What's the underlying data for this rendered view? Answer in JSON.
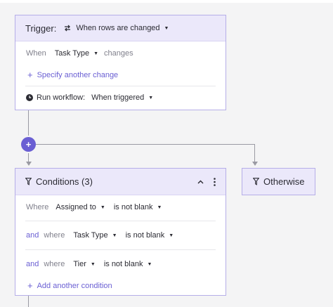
{
  "trigger": {
    "title": "Trigger:",
    "type_label": "When rows are changed",
    "when_label": "When",
    "field_label": "Task Type",
    "changes_label": "changes",
    "specify_label": "Specify another change",
    "run_label": "Run workflow:",
    "run_value": "When triggered"
  },
  "add_step": {
    "label": "+"
  },
  "conditions": {
    "title": "Conditions (3)",
    "rows": [
      {
        "conj": "",
        "where": "Where",
        "field": "Assigned to",
        "op": "is not blank"
      },
      {
        "conj": "and",
        "where": "where",
        "field": "Task Type",
        "op": "is not blank"
      },
      {
        "conj": "and",
        "where": "where",
        "field": "Tier",
        "op": "is not blank"
      }
    ],
    "add_label": "Add another condition"
  },
  "otherwise": {
    "title": "Otherwise"
  },
  "colors": {
    "accent": "#6a5fd3",
    "header_bg": "#ebe8fa",
    "border": "#b6aee8",
    "connector": "#9a9aa3"
  }
}
